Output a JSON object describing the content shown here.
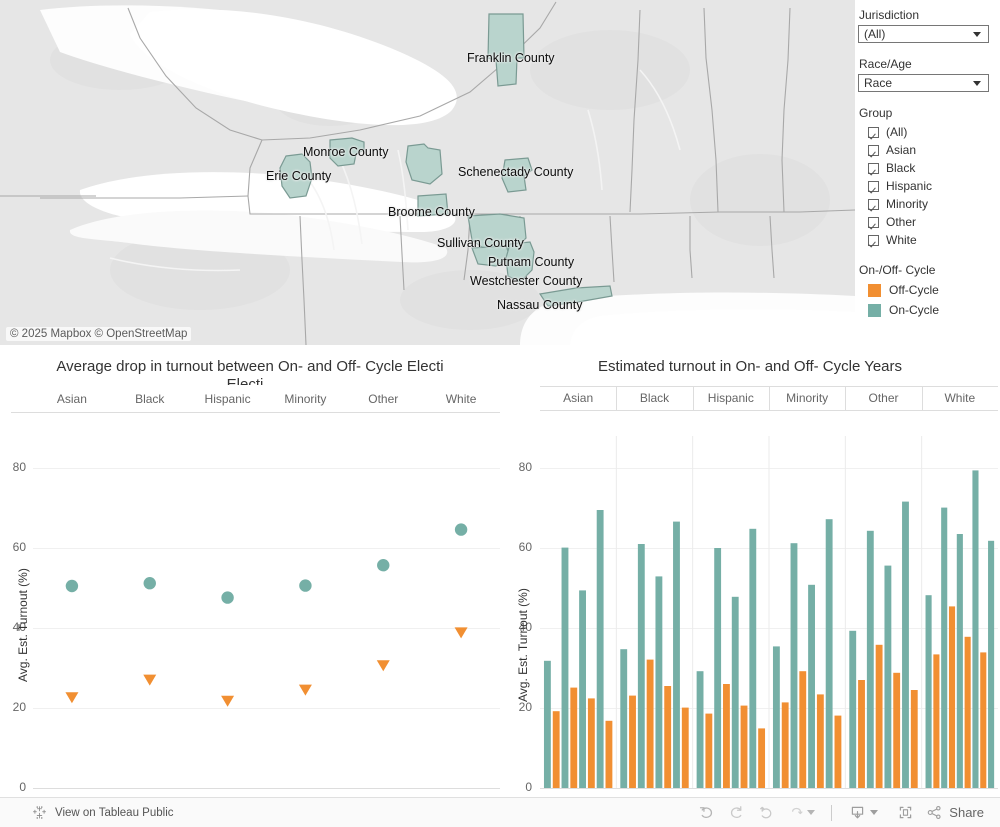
{
  "map": {
    "attribution": "© 2025 Mapbox © OpenStreetMap",
    "counties": [
      {
        "name": "Franklin County"
      },
      {
        "name": "Monroe County"
      },
      {
        "name": "Erie County"
      },
      {
        "name": "Schenectady County"
      },
      {
        "name": "Broome County"
      },
      {
        "name": "Sullivan County"
      },
      {
        "name": "Putnam County"
      },
      {
        "name": "Westchester County"
      },
      {
        "name": "Nassau County"
      }
    ],
    "county_fill": "#b9d4cd",
    "county_stroke": "#7a9a93"
  },
  "controls": {
    "jurisdiction": {
      "title": "Jurisdiction",
      "value": "(All)"
    },
    "race_age": {
      "title": "Race/Age",
      "value": "Race"
    },
    "group": {
      "title": "Group",
      "items": [
        {
          "label": "(All)",
          "checked": true
        },
        {
          "label": "Asian",
          "checked": true
        },
        {
          "label": "Black",
          "checked": true
        },
        {
          "label": "Hispanic",
          "checked": true
        },
        {
          "label": "Minority",
          "checked": true
        },
        {
          "label": "Other",
          "checked": true
        },
        {
          "label": "White",
          "checked": true
        }
      ]
    },
    "cycle_legend": {
      "title": "On-/Off- Cycle",
      "items": [
        {
          "label": "Off-Cycle",
          "color": "#F18F32"
        },
        {
          "label": "On-Cycle",
          "color": "#75AFA6"
        }
      ]
    }
  },
  "chart_data": [
    {
      "id": "left",
      "type": "bar",
      "title": "Average drop in turnout between On- and Off- Cycle Electi",
      "ylabel": "Avg. Est. Turnout (%)",
      "xlabel": "",
      "categories": [
        "Asian",
        "Black",
        "Hispanic",
        "Minority",
        "Other",
        "White"
      ],
      "ylim": [
        0,
        90
      ],
      "yticks": [
        0,
        20,
        40,
        60,
        80
      ],
      "grid": true,
      "series": [
        {
          "name": "On-Cycle",
          "color": "#75AFA6",
          "values": [
            50.5,
            51.2,
            47.6,
            50.6,
            55.7,
            64.6
          ]
        },
        {
          "name": "Off-Cycle",
          "color": "#F18F32",
          "values": [
            21.2,
            25.6,
            20.3,
            23.1,
            29.2,
            37.4
          ]
        }
      ]
    },
    {
      "id": "right",
      "type": "bar",
      "title": "Estimated turnout in On- and Off- Cycle Years",
      "ylabel": "Avg. Est. Turnout (%)",
      "xlabel": "",
      "categories": [
        "Asian",
        "Black",
        "Hispanic",
        "Minority",
        "Other",
        "White"
      ],
      "ylim": [
        0,
        90
      ],
      "yticks": [
        0,
        20,
        40,
        60,
        80
      ],
      "grid": true,
      "groups": [
        {
          "name": "Asian",
          "bars": [
            {
              "series": "On-Cycle",
              "value": 31.8
            },
            {
              "series": "Off-Cycle",
              "value": 19.2
            },
            {
              "series": "On-Cycle",
              "value": 60.1
            },
            {
              "series": "Off-Cycle",
              "value": 25.1
            },
            {
              "series": "On-Cycle",
              "value": 49.4
            },
            {
              "series": "Off-Cycle",
              "value": 22.4
            },
            {
              "series": "On-Cycle",
              "value": 69.5
            },
            {
              "series": "Off-Cycle",
              "value": 16.8
            }
          ]
        },
        {
          "name": "Black",
          "bars": [
            {
              "series": "On-Cycle",
              "value": 34.7
            },
            {
              "series": "Off-Cycle",
              "value": 23.1
            },
            {
              "series": "On-Cycle",
              "value": 61.0
            },
            {
              "series": "Off-Cycle",
              "value": 32.1
            },
            {
              "series": "On-Cycle",
              "value": 52.9
            },
            {
              "series": "Off-Cycle",
              "value": 25.5
            },
            {
              "series": "On-Cycle",
              "value": 66.6
            },
            {
              "series": "Off-Cycle",
              "value": 20.1
            }
          ]
        },
        {
          "name": "Hispanic",
          "bars": [
            {
              "series": "On-Cycle",
              "value": 29.2
            },
            {
              "series": "Off-Cycle",
              "value": 18.6
            },
            {
              "series": "On-Cycle",
              "value": 60.0
            },
            {
              "series": "Off-Cycle",
              "value": 26.0
            },
            {
              "series": "On-Cycle",
              "value": 47.8
            },
            {
              "series": "Off-Cycle",
              "value": 20.6
            },
            {
              "series": "On-Cycle",
              "value": 64.8
            },
            {
              "series": "Off-Cycle",
              "value": 14.9
            }
          ]
        },
        {
          "name": "Minority",
          "bars": [
            {
              "series": "On-Cycle",
              "value": 35.4
            },
            {
              "series": "Off-Cycle",
              "value": 21.4
            },
            {
              "series": "On-Cycle",
              "value": 61.2
            },
            {
              "series": "Off-Cycle",
              "value": 29.2
            },
            {
              "series": "On-Cycle",
              "value": 50.8
            },
            {
              "series": "Off-Cycle",
              "value": 23.4
            },
            {
              "series": "On-Cycle",
              "value": 67.2
            },
            {
              "series": "Off-Cycle",
              "value": 18.1
            }
          ]
        },
        {
          "name": "Other",
          "bars": [
            {
              "series": "On-Cycle",
              "value": 39.3
            },
            {
              "series": "Off-Cycle",
              "value": 27.0
            },
            {
              "series": "On-Cycle",
              "value": 64.3
            },
            {
              "series": "Off-Cycle",
              "value": 35.8
            },
            {
              "series": "On-Cycle",
              "value": 55.6
            },
            {
              "series": "Off-Cycle",
              "value": 28.8
            },
            {
              "series": "On-Cycle",
              "value": 71.6
            },
            {
              "series": "Off-Cycle",
              "value": 24.5
            }
          ]
        },
        {
          "name": "White",
          "bars": [
            {
              "series": "On-Cycle",
              "value": 48.2
            },
            {
              "series": "Off-Cycle",
              "value": 33.4
            },
            {
              "series": "On-Cycle",
              "value": 70.1
            },
            {
              "series": "Off-Cycle",
              "value": 45.4
            },
            {
              "series": "On-Cycle",
              "value": 63.5
            },
            {
              "series": "Off-Cycle",
              "value": 37.8
            },
            {
              "series": "On-Cycle",
              "value": 79.4
            },
            {
              "series": "Off-Cycle",
              "value": 33.9
            },
            {
              "series": "On-Cycle",
              "value": 61.8
            }
          ]
        }
      ]
    }
  ],
  "toolbar": {
    "tableau_link": "View on Tableau Public",
    "share_label": "Share",
    "buttons": [
      {
        "name": "undo",
        "glyph": "undo"
      },
      {
        "name": "redo",
        "glyph": "redo"
      },
      {
        "name": "revert",
        "glyph": "revert"
      },
      {
        "name": "refresh",
        "glyph": "refresh"
      },
      {
        "name": "pause",
        "glyph": "pause"
      },
      {
        "name": "download",
        "glyph": "download"
      },
      {
        "name": "fullscreen",
        "glyph": "fullscreen"
      }
    ]
  }
}
